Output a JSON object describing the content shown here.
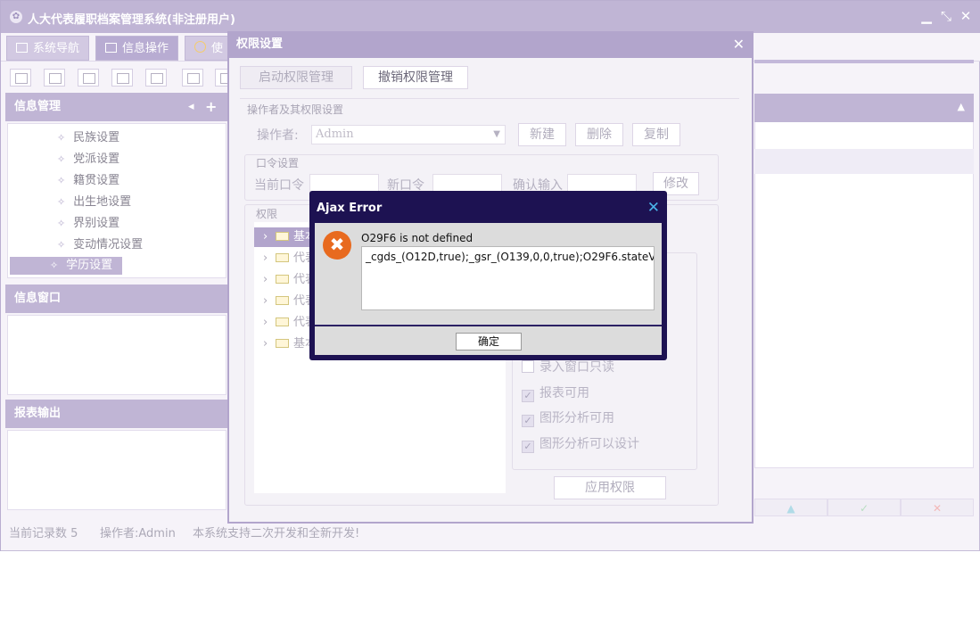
{
  "app": {
    "title": "人大代表履职档案管理系统(非注册用户)",
    "logo_icon": "app-logo-icon",
    "colors": {
      "accent": "#b2a5cc",
      "error_frame": "#1d1252",
      "error_icon": "#e86a1f"
    }
  },
  "main_tabs": [
    {
      "label": "系统导航",
      "icon": "monitor-icon"
    },
    {
      "label": "信息操作",
      "icon": "grid-icon"
    },
    {
      "label": "使",
      "icon": "clock-icon"
    }
  ],
  "sidebar": {
    "info_manage": {
      "title": "信息管理",
      "items": [
        "民族设置",
        "党派设置",
        "籍贯设置",
        "出生地设置",
        "界别设置",
        "变动情况设置",
        "学历设置"
      ],
      "selected": "学历设置"
    },
    "info_window": {
      "title": "信息窗口"
    },
    "report_output": {
      "title": "报表输出"
    }
  },
  "status": {
    "record_count": "当前记录数 5",
    "operator": "操作者:Admin",
    "slogan": "本系统支持二次开发和全新开发!"
  },
  "permission_dialog": {
    "title": "权限设置",
    "enable_btn": "启动权限管理",
    "revoke_btn": "撤销权限管理",
    "operator_section": "操作者及其权限设置",
    "operator_label": "操作者:",
    "operator_value": "Admin",
    "new_btn": "新建",
    "delete_btn": "删除",
    "copy_btn": "复制",
    "password_section": "口令设置",
    "current_pwd": "当前口令",
    "new_pwd": "新口令",
    "confirm_pwd": "确认输入",
    "modify_btn": "修改",
    "permission_section": "权限",
    "tree": [
      {
        "label": "基本",
        "selected": true
      },
      {
        "label": "代表",
        "selected": false
      },
      {
        "label": "代表",
        "selected": false
      },
      {
        "label": "代表",
        "selected": false
      },
      {
        "label": "代表",
        "selected": false
      },
      {
        "label": "基本",
        "selected": false
      }
    ],
    "checks": [
      {
        "label": "录入窗口只读",
        "checked": false
      },
      {
        "label": "报表可用",
        "checked": true
      },
      {
        "label": "图形分析可用",
        "checked": true
      },
      {
        "label": "图形分析可以设计",
        "checked": true
      }
    ],
    "apply_btn": "应用权限"
  },
  "error_dialog": {
    "title": "Ajax Error",
    "message": "O29F6 is not defined",
    "detail": "_cgds_(O12D,true);_gsr_(O139,0,0,true);O29F6.stateV",
    "ok_btn": "确定"
  }
}
